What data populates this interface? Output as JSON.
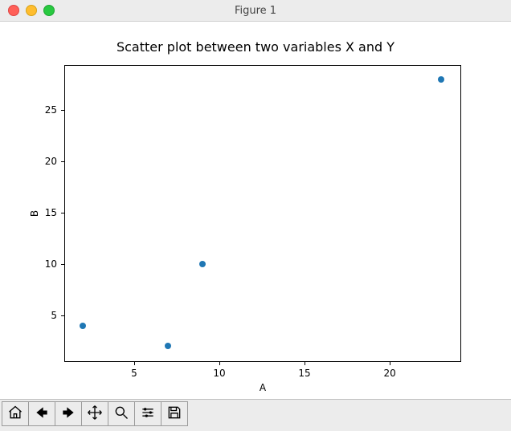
{
  "window": {
    "title": "Figure 1"
  },
  "chart_data": {
    "type": "scatter",
    "title": "Scatter plot between two variables X and Y",
    "xlabel": "A",
    "ylabel": "B",
    "xlim": [
      0.95,
      24.05
    ],
    "ylim": [
      0.7,
      29.3
    ],
    "xticks": [
      5,
      10,
      15,
      20
    ],
    "yticks": [
      5,
      10,
      15,
      20,
      25
    ],
    "x": [
      2,
      7,
      9,
      23
    ],
    "y": [
      4,
      2,
      10,
      28
    ],
    "point_color": "#1f77b4"
  },
  "toolbar": {
    "buttons": [
      {
        "name": "home-button",
        "icon": "home-icon"
      },
      {
        "name": "back-button",
        "icon": "arrow-left-icon"
      },
      {
        "name": "forward-button",
        "icon": "arrow-right-icon"
      },
      {
        "name": "pan-button",
        "icon": "move-icon"
      },
      {
        "name": "zoom-button",
        "icon": "magnifier-icon"
      },
      {
        "name": "subplots-button",
        "icon": "sliders-icon"
      },
      {
        "name": "save-button",
        "icon": "save-icon"
      }
    ]
  }
}
